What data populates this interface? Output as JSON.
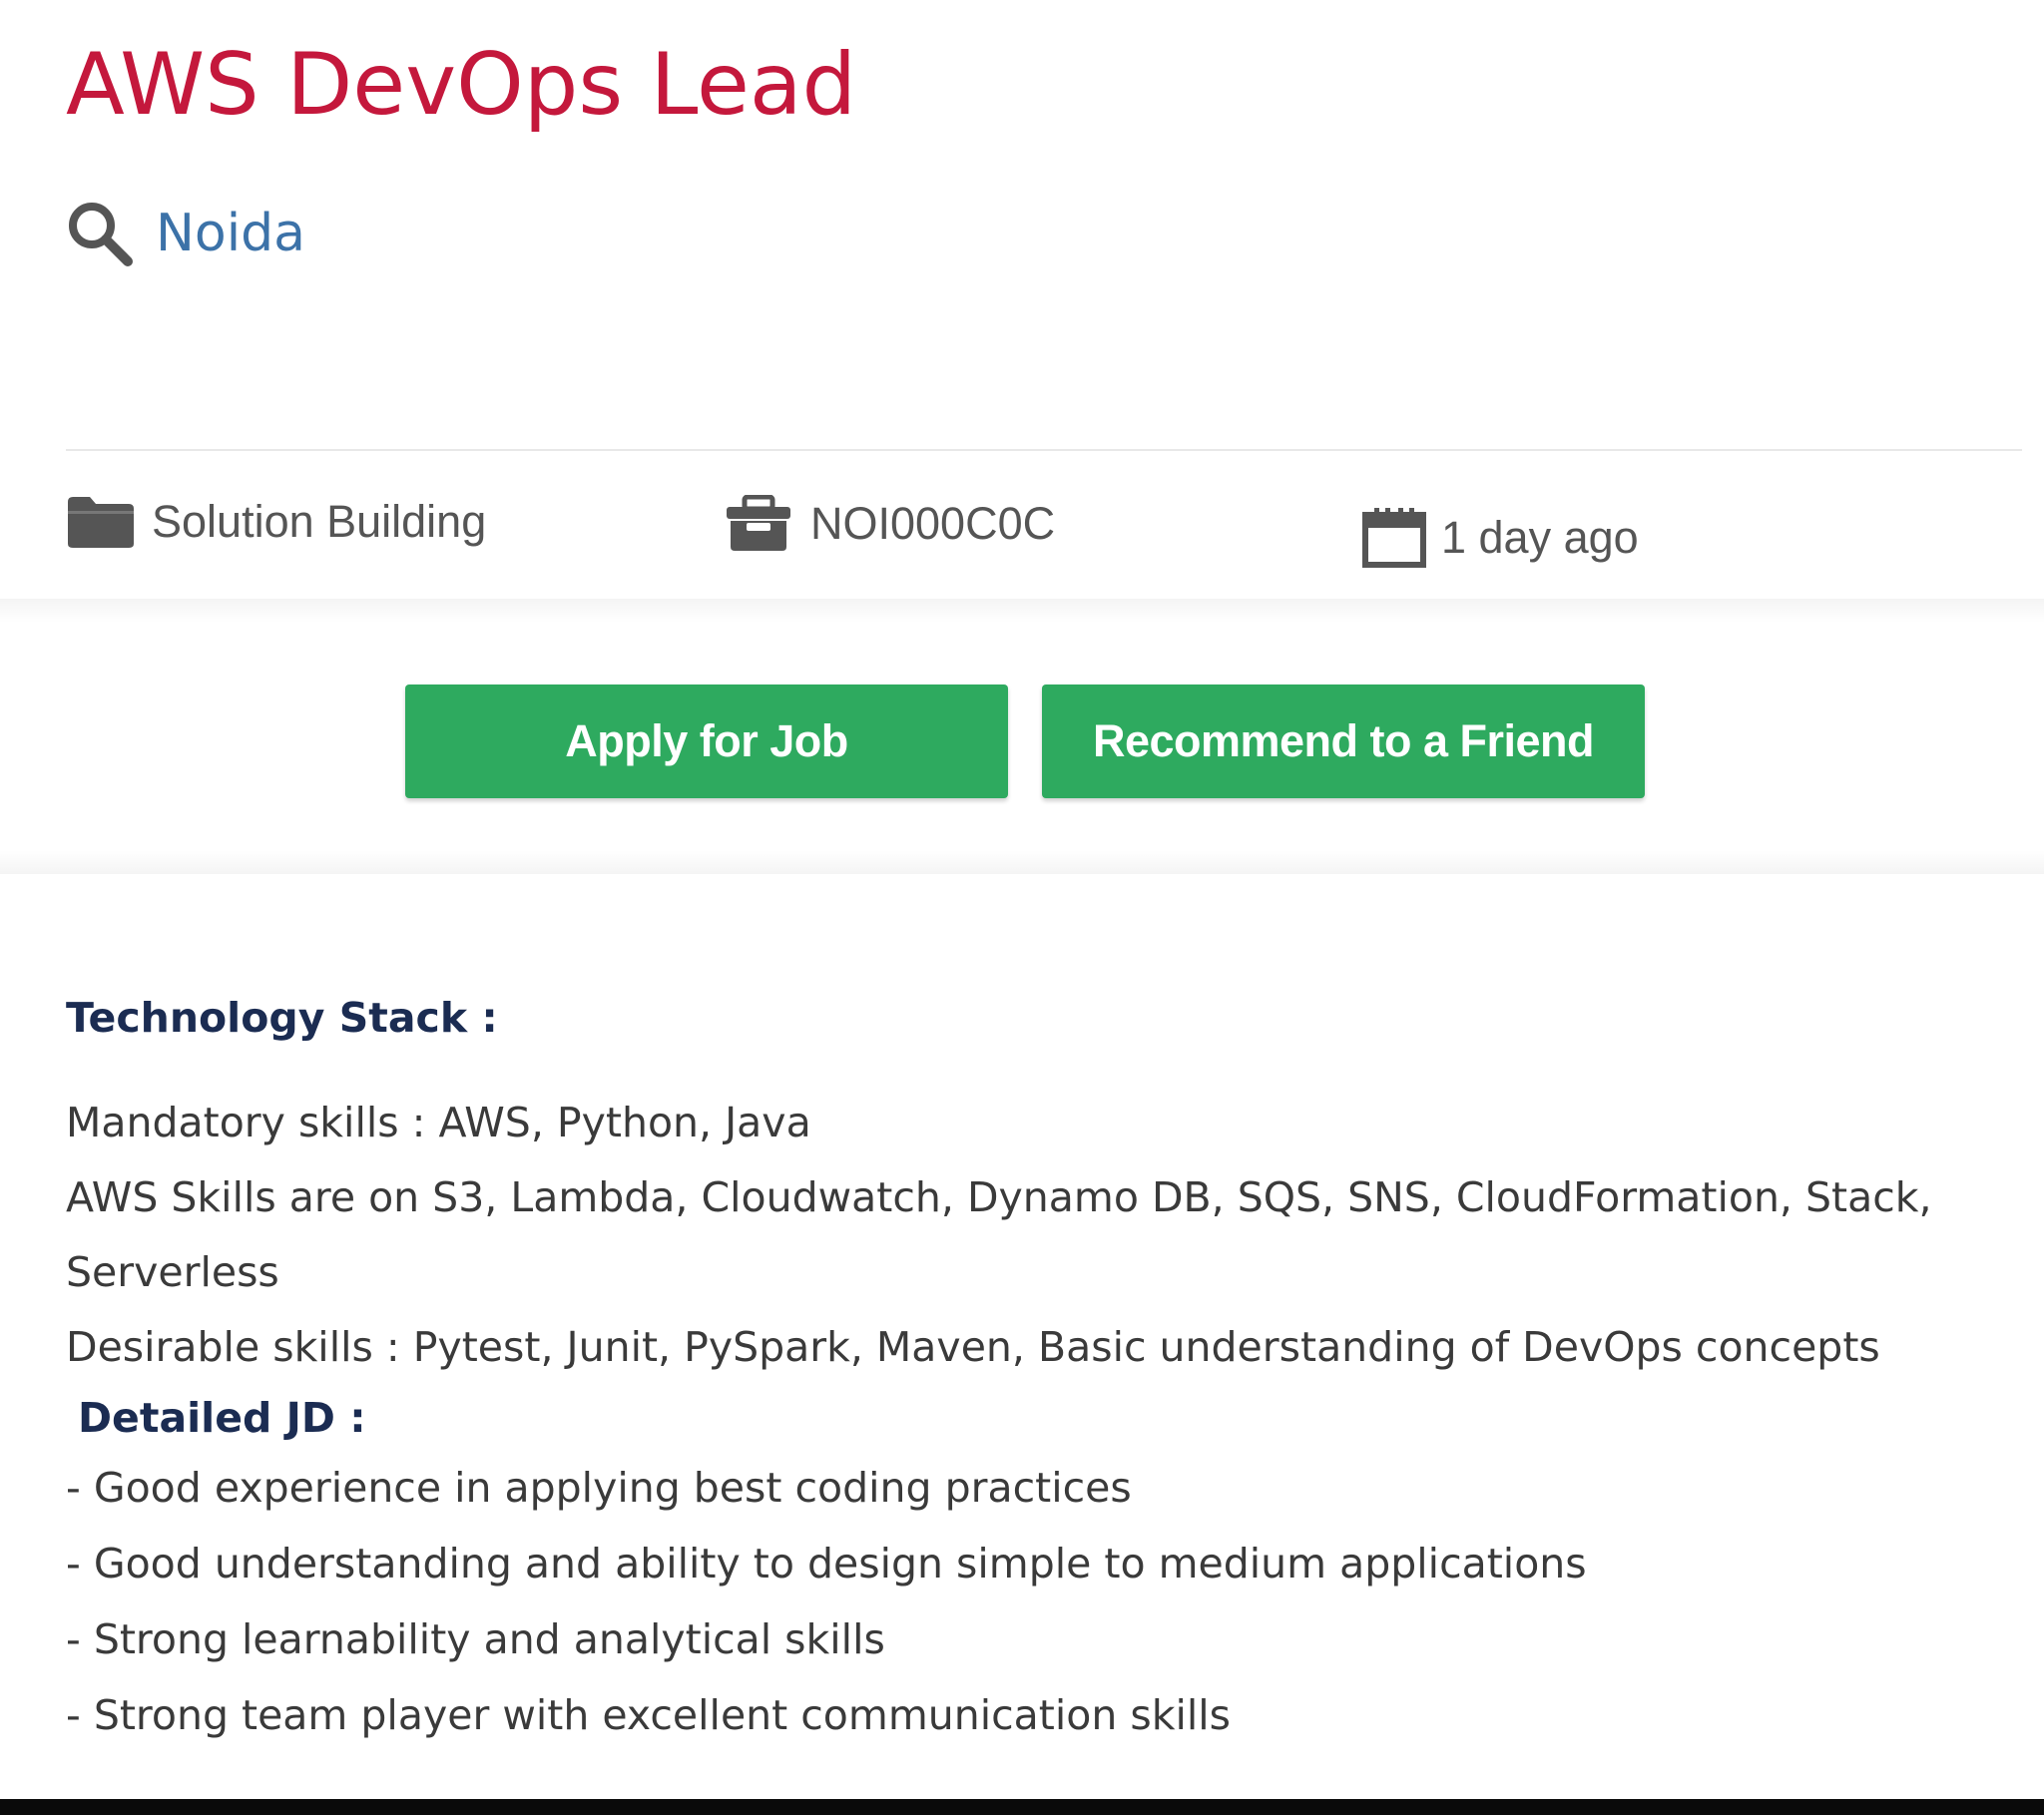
{
  "job": {
    "title": "AWS DevOps Lead",
    "location": "Noida",
    "category": "Solution Building",
    "code": "NOI000C0C",
    "posted": "1 day ago"
  },
  "actions": {
    "apply_label": "Apply for Job",
    "recommend_label": "Recommend to a Friend"
  },
  "description": {
    "tech_heading": "Technology Stack :",
    "tech_lines": [
      "Mandatory skills : AWS,  Python, Java",
      "AWS Skills are on S3, Lambda, Cloudwatch, Dynamo DB, SQS, SNS, CloudFormation, Stack,",
      "Serverless",
      "Desirable skills : Pytest, Junit, PySpark, Maven, Basic understanding of DevOps concepts"
    ],
    "jd_heading": "Detailed JD :",
    "jd_lines": [
      "- Good experience in applying best coding practices",
      "- Good understanding and ability to design simple to medium applications",
      "- Strong learnability and analytical skills",
      "- Strong team player with excellent communication skills"
    ]
  },
  "icons": {
    "location": "search-icon",
    "category": "folder-icon",
    "code": "briefcase-icon",
    "posted": "calendar-icon"
  },
  "colors": {
    "title": "#c4183c",
    "location": "#3c72a8",
    "button": "#2eaa5f",
    "heading": "#1b2c52",
    "icon": "#555555"
  }
}
